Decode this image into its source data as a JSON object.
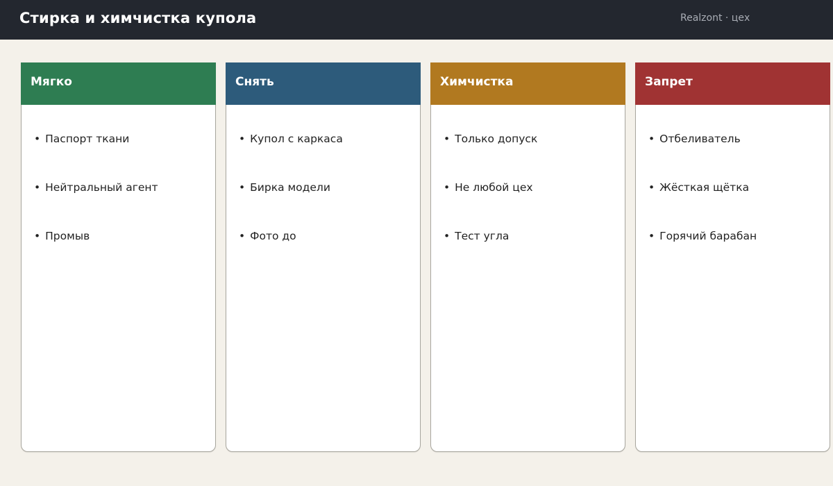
{
  "header": {
    "title": "Стирка и химчистка купола",
    "subtitle": "Realzont · цех"
  },
  "columns": [
    {
      "title": "Мягко",
      "color": "#2e7d52",
      "items": [
        "Паспорт ткани",
        "Нейтральный агент",
        "Промыв"
      ]
    },
    {
      "title": "Снять",
      "color": "#2d5b7b",
      "items": [
        "Купол с каркаса",
        "Бирка модели",
        "Фото до"
      ]
    },
    {
      "title": "Химчистка",
      "color": "#b17920",
      "items": [
        "Только допуск",
        "Не любой цех",
        "Тест угла"
      ]
    },
    {
      "title": "Запрет",
      "color": "#a03333",
      "items": [
        "Отбеливатель",
        "Жёсткая щётка",
        "Горячий барабан"
      ]
    }
  ],
  "bullet": "•"
}
